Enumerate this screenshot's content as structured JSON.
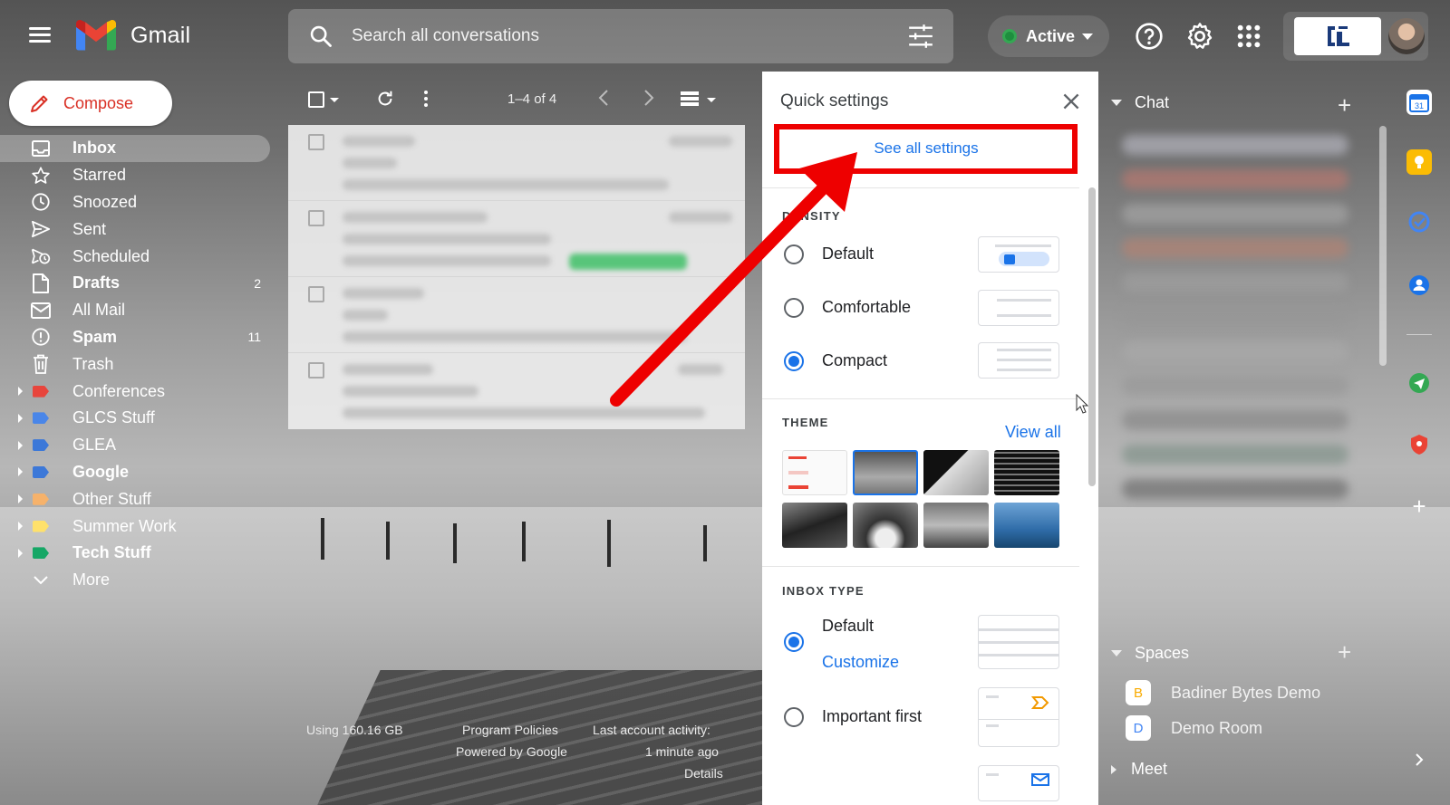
{
  "app": {
    "name": "Gmail"
  },
  "search": {
    "placeholder": "Search all conversations"
  },
  "status": {
    "label": "Active",
    "color": "#34a853"
  },
  "compose": {
    "label": "Compose"
  },
  "nav": [
    {
      "label": "Inbox",
      "count": "",
      "bold": true,
      "icon": "inbox-icon",
      "active": true
    },
    {
      "label": "Starred",
      "count": "",
      "bold": false,
      "icon": "star-icon"
    },
    {
      "label": "Snoozed",
      "count": "",
      "bold": false,
      "icon": "clock-icon"
    },
    {
      "label": "Sent",
      "count": "",
      "bold": false,
      "icon": "send-icon"
    },
    {
      "label": "Scheduled",
      "count": "",
      "bold": false,
      "icon": "scheduled-send-icon"
    },
    {
      "label": "Drafts",
      "count": "2",
      "bold": true,
      "icon": "draft-icon"
    },
    {
      "label": "All Mail",
      "count": "",
      "bold": false,
      "icon": "mail-icon"
    },
    {
      "label": "Spam",
      "count": "11",
      "bold": true,
      "icon": "report-icon"
    },
    {
      "label": "Trash",
      "count": "",
      "bold": false,
      "icon": "trash-icon"
    },
    {
      "label": "Conferences",
      "count": "",
      "bold": false,
      "icon": "label-icon",
      "color": "#e8453c"
    },
    {
      "label": "GLCS Stuff",
      "count": "",
      "bold": false,
      "icon": "label-icon",
      "color": "#4a86e8"
    },
    {
      "label": "GLEA",
      "count": "",
      "bold": false,
      "icon": "label-icon",
      "color": "#3c78d8"
    },
    {
      "label": "Google",
      "count": "",
      "bold": true,
      "icon": "label-icon",
      "color": "#3c78d8"
    },
    {
      "label": "Other Stuff",
      "count": "",
      "bold": false,
      "icon": "label-icon",
      "color": "#f6b26b"
    },
    {
      "label": "Summer Work",
      "count": "",
      "bold": false,
      "icon": "label-icon",
      "color": "#ffe16b"
    },
    {
      "label": "Tech Stuff",
      "count": "",
      "bold": true,
      "icon": "label-icon",
      "color": "#16a766"
    },
    {
      "label": "More",
      "count": "",
      "bold": false,
      "icon": "chevron-down-icon"
    }
  ],
  "mail_list": {
    "range": "1–4 of 4"
  },
  "footer": {
    "storage": "Using 160.16 GB",
    "policies": "Program Policies",
    "powered": "Powered by Google",
    "activity": "Last account activity:",
    "activity_time": "1 minute ago",
    "details": "Details"
  },
  "quick_settings": {
    "title": "Quick settings",
    "see_all": "See all settings",
    "density": {
      "heading": "DENSITY",
      "options": [
        {
          "label": "Default",
          "selected": false
        },
        {
          "label": "Comfortable",
          "selected": false
        },
        {
          "label": "Compact",
          "selected": true
        }
      ]
    },
    "theme": {
      "heading": "THEME",
      "view_all": "View all"
    },
    "inbox_type": {
      "heading": "INBOX TYPE",
      "options": [
        {
          "label": "Default",
          "selected": true,
          "link": "Customize"
        },
        {
          "label": "Important first",
          "selected": false
        }
      ]
    }
  },
  "chat": {
    "heading": "Chat",
    "spaces_heading": "Spaces",
    "spaces": [
      {
        "initial": "B",
        "name": "Badiner Bytes Demo",
        "color": "#f9ab00"
      },
      {
        "initial": "D",
        "name": "Demo Room",
        "color": "#4285f4"
      }
    ],
    "meet_heading": "Meet"
  },
  "colors": {
    "accent": "#1a73e8",
    "compose_text": "#d93025",
    "highlight": "#ee0000"
  }
}
